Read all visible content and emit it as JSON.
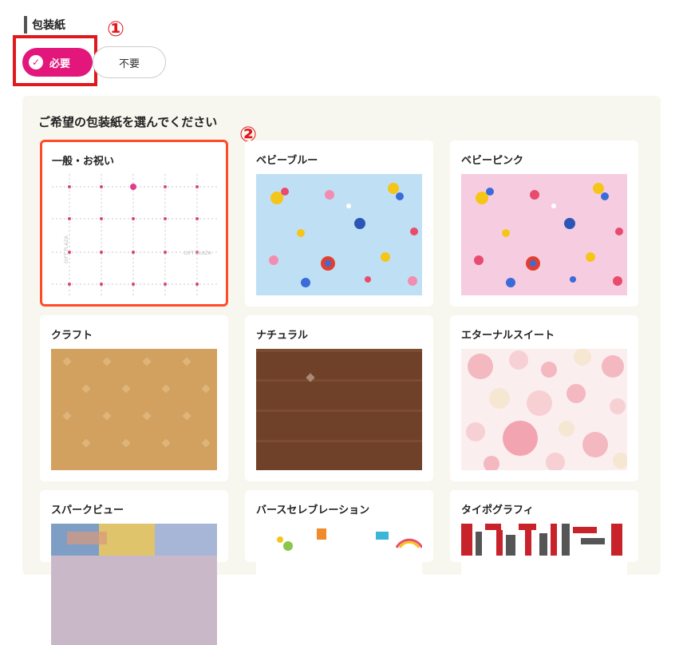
{
  "section": {
    "title": "包装紙"
  },
  "options": {
    "need_label": "必要",
    "no_need_label": "不要"
  },
  "annotations": {
    "one": "①",
    "two": "②"
  },
  "panel": {
    "heading": "ご希望の包装紙を選んでください"
  },
  "papers": [
    {
      "name": "一般・お祝い",
      "selected": true,
      "pattern_text": "GIFT PLAZA"
    },
    {
      "name": "ベビーブルー"
    },
    {
      "name": "ベビーピンク"
    },
    {
      "name": "クラフト"
    },
    {
      "name": "ナチュラル"
    },
    {
      "name": "エターナルスイート"
    },
    {
      "name": "スパークビュー"
    },
    {
      "name": "バースセレブレーション"
    },
    {
      "name": "タイポグラフィ"
    }
  ],
  "colors": {
    "accent": "#e2167b",
    "annotation": "#e0191c",
    "selected_border": "#ff4b28",
    "panel_bg": "#f8f7ef"
  }
}
